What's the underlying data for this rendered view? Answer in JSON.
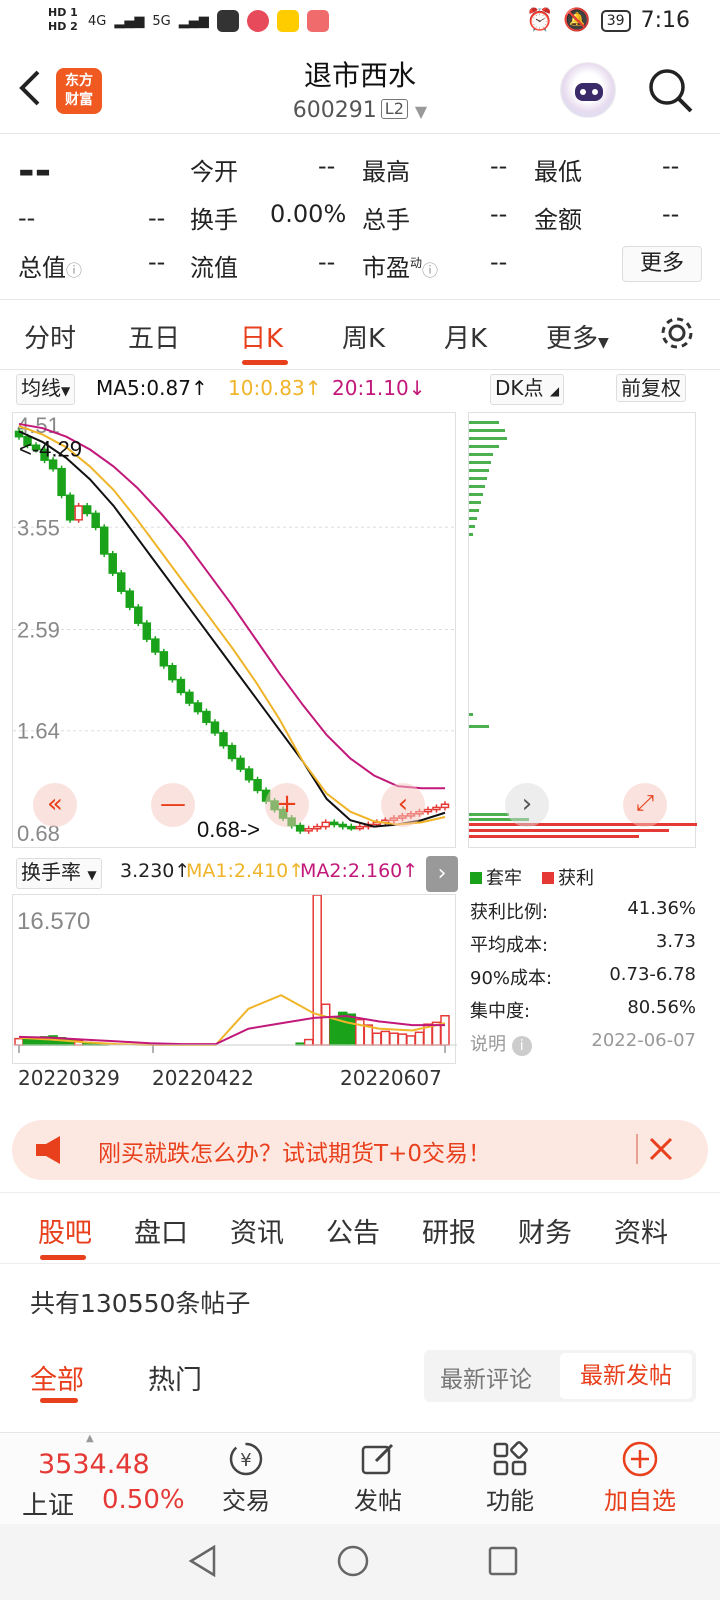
{
  "status": {
    "hd1": "HD 1",
    "hd2": "HD 2",
    "net1": "4G",
    "net2": "5G",
    "battery": "39",
    "time": "7:16"
  },
  "header": {
    "logo_line1": "东方",
    "logo_line2": "财富",
    "title": "退市西水",
    "code": "600291",
    "level": "L2"
  },
  "quote": {
    "price": "--",
    "change": "--",
    "change_pct": "--",
    "open_label": "今开",
    "open": "--",
    "high_label": "最高",
    "high": "--",
    "low_label": "最低",
    "low": "--",
    "turnover_label": "换手",
    "turnover": "0.00%",
    "volume_label": "总手",
    "volume": "--",
    "amount_label": "金额",
    "amount": "--",
    "mktcap_label": "总值",
    "mktcap": "--",
    "float_label": "流值",
    "float": "--",
    "pe_label": "市盈",
    "pe_sup": "动",
    "pe": "--",
    "more": "更多"
  },
  "ktabs": [
    "分时",
    "五日",
    "日K",
    "周K",
    "月K",
    "更多"
  ],
  "ma": {
    "selector": "均线",
    "ma5": "MA5:0.87",
    "ma10": "10:0.83",
    "ma20": "20:1.10",
    "dk": "DK点",
    "fq": "前复权"
  },
  "chart_data": [
    {
      "type": "candlestick",
      "yticks": [
        "4.51",
        "3.55",
        "2.59",
        "1.64",
        "0.68"
      ],
      "ylim": [
        0.68,
        4.51
      ],
      "annotations": [
        "<-4.29",
        "0.68->"
      ],
      "closes": [
        4.4,
        4.32,
        4.28,
        4.18,
        4.1,
        3.85,
        3.62,
        3.75,
        3.68,
        3.55,
        3.3,
        3.12,
        2.95,
        2.8,
        2.65,
        2.5,
        2.38,
        2.25,
        2.12,
        2.0,
        1.9,
        1.82,
        1.72,
        1.62,
        1.5,
        1.38,
        1.28,
        1.18,
        1.08,
        0.98,
        0.9,
        0.82,
        0.75,
        0.7,
        0.72,
        0.74,
        0.78,
        0.76,
        0.74,
        0.73,
        0.74,
        0.76,
        0.78,
        0.8,
        0.82,
        0.84,
        0.86,
        0.88,
        0.9,
        0.92,
        0.95
      ],
      "series": [
        {
          "name": "MA5",
          "values": [
            4.45,
            4.35,
            4.2,
            4.0,
            3.75,
            3.45,
            3.15,
            2.85,
            2.55,
            2.25,
            1.95,
            1.65,
            1.35,
            1.0,
            0.8,
            0.74,
            0.76,
            0.8,
            0.87
          ]
        },
        {
          "name": "MA10",
          "values": [
            4.5,
            4.42,
            4.3,
            4.12,
            3.9,
            3.62,
            3.32,
            3.02,
            2.72,
            2.42,
            2.1,
            1.75,
            1.35,
            1.05,
            0.88,
            0.79,
            0.76,
            0.78,
            0.83
          ]
        },
        {
          "name": "MA20",
          "values": [
            4.52,
            4.48,
            4.4,
            4.28,
            4.12,
            3.92,
            3.68,
            3.42,
            3.12,
            2.82,
            2.5,
            2.18,
            1.88,
            1.6,
            1.38,
            1.22,
            1.12,
            1.1,
            1.1
          ]
        }
      ]
    },
    {
      "type": "bar",
      "title": "换手率",
      "max_label": "16.570",
      "x_labels": [
        "20220329",
        "20220422",
        "20220607"
      ],
      "values": [
        0.7,
        0.8,
        0.8,
        0.9,
        1.0,
        0.8,
        0.6,
        0.5,
        0.3,
        0.2,
        0.1,
        0.0,
        0.0,
        0.0,
        0.0,
        0.0,
        0.0,
        0.0,
        0.0,
        0.0,
        0.0,
        0.0,
        0.0,
        0.0,
        0.0,
        0.0,
        0.0,
        0.0,
        0.0,
        0.0,
        0.0,
        0.0,
        0.0,
        0.2,
        0.6,
        16.57,
        4.5,
        3.0,
        3.6,
        3.4,
        2.8,
        2.2,
        1.3,
        1.5,
        1.3,
        1.2,
        1.0,
        1.4,
        2.3,
        2.5,
        3.23
      ],
      "series": [
        {
          "name": "MA1",
          "values": [
            0.8,
            0.6,
            0.3,
            0.1,
            0.0,
            0.0,
            0.0,
            4.0,
            5.5,
            3.5,
            2.5,
            1.8,
            1.6,
            2.4
          ]
        },
        {
          "name": "MA2",
          "values": [
            0.9,
            0.8,
            0.6,
            0.4,
            0.2,
            0.1,
            0.1,
            1.8,
            2.4,
            3.0,
            3.2,
            2.6,
            2.2,
            2.2
          ]
        }
      ]
    }
  ],
  "turnover": {
    "selector": "换手率",
    "val": "3.230",
    "ma1": "MA1:2.410",
    "ma2": "MA2:2.160"
  },
  "dist": {
    "legend_trapped": "套牢",
    "legend_profit": "获利",
    "profit_ratio_label": "获利比例:",
    "profit_ratio": "41.36%",
    "avg_cost_label": "平均成本:",
    "avg_cost": "3.73",
    "cost90_label": "90%成本:",
    "cost90": "0.73-6.78",
    "concentration_label": "集中度:",
    "concentration": "80.56%",
    "explain": "说明",
    "date": "2022-06-07"
  },
  "banner": {
    "text": "刚买就跌怎么办？试试期货T+0交易！"
  },
  "newsTabs": [
    "股吧",
    "盘口",
    "资讯",
    "公告",
    "研报",
    "财务",
    "资料"
  ],
  "posts": {
    "count_text": "共有130550条帖子",
    "filter_all": "全部",
    "filter_hot": "热门",
    "sort_comment": "最新评论",
    "sort_post": "最新发帖"
  },
  "bottom": {
    "index_value": "3534.48",
    "index_name": "上证",
    "index_pct": "0.50%",
    "trade": "交易",
    "post": "发帖",
    "func": "功能",
    "add": "加自选"
  },
  "colors": {
    "accent": "#e8401c",
    "up": "#e53935",
    "down": "#1aa31a",
    "ma5": "#111111",
    "ma10": "#f0b429",
    "ma20": "#c2187a"
  }
}
